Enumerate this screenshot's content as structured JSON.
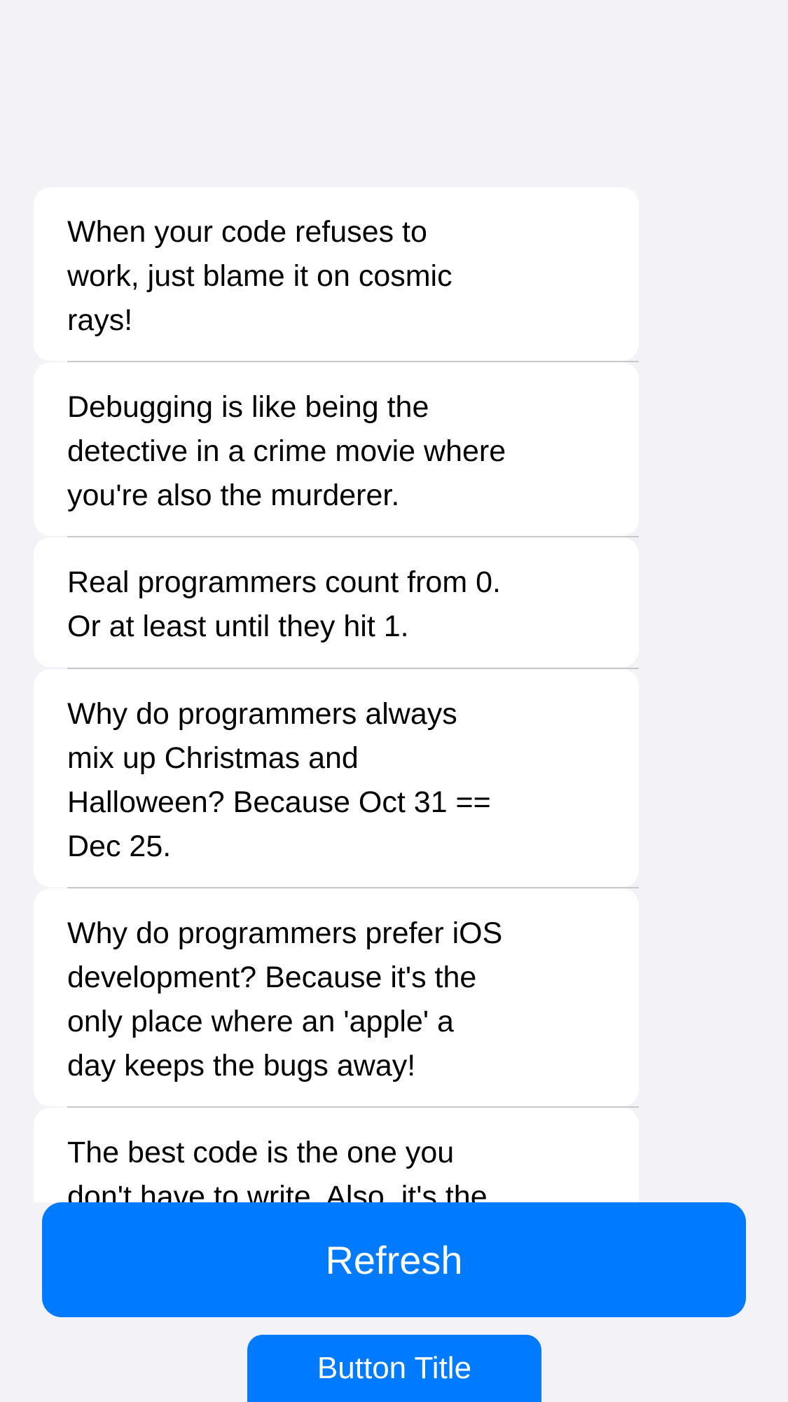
{
  "jokes": [
    {
      "text": "When your code refuses to\nwork, just blame it on cosmic\nrays!"
    },
    {
      "text": "Debugging is like being the\ndetective in a crime movie where\nyou're also the murderer."
    },
    {
      "text": "Real programmers count from 0.\nOr at least until they hit 1."
    },
    {
      "text": "Why do programmers always\nmix up Christmas and\nHalloween? Because Oct 31 ==\nDec 25."
    },
    {
      "text": "Why do programmers prefer iOS\ndevelopment? Because it's the\nonly place where an 'apple' a\nday keeps the bugs away!"
    },
    {
      "text": "The best code is the one you\ndon't have to write. Also, it's the"
    }
  ],
  "actions": {
    "refresh_label": "Refresh",
    "secondary_label": "Button Title"
  },
  "colors": {
    "background": "#f2f2f7",
    "cell": "#ffffff",
    "accent": "#007aff",
    "separator": "#c8c8cc"
  }
}
